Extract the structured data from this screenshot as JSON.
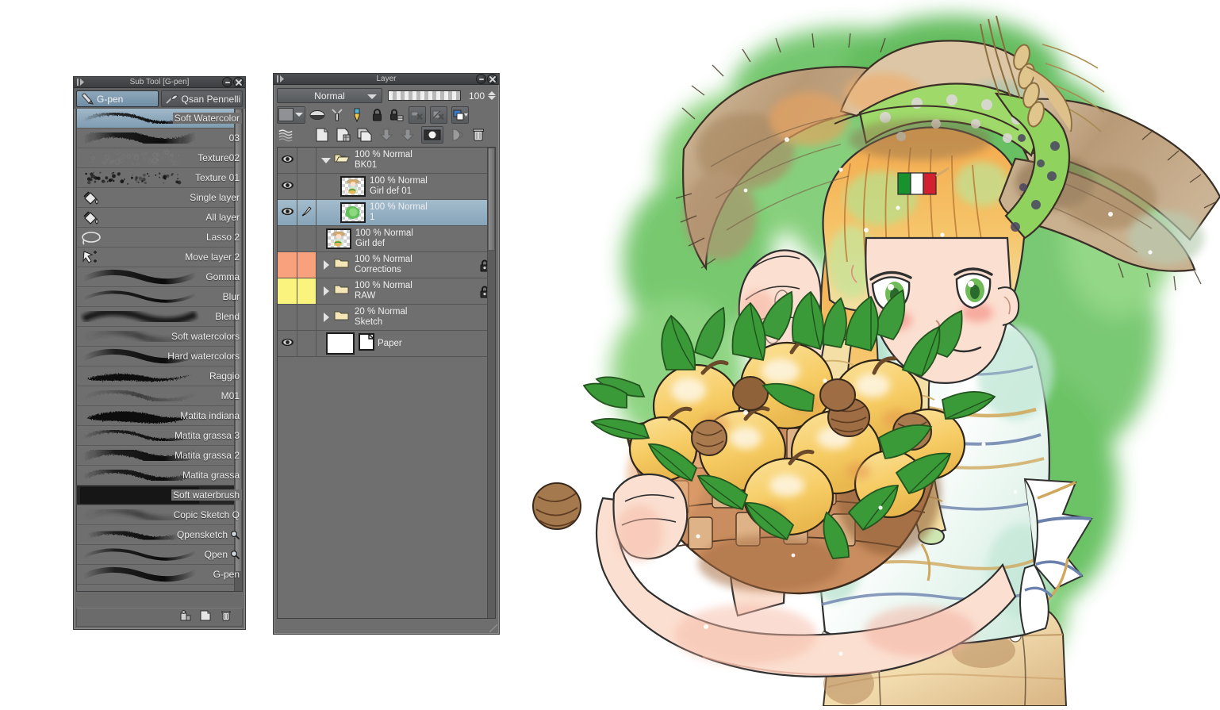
{
  "app": "Clip Studio Paint",
  "subtool_palette": {
    "title": "Sub Tool [G-pen]",
    "grip_icon": "drag-grip-icon",
    "minimize_label": "—",
    "close_label": "✕",
    "tabs": [
      {
        "label": "G-pen",
        "icon": "pen-icon",
        "active": true
      },
      {
        "label": "Qsan Pennelli",
        "icon": "brush-icon",
        "active": false
      }
    ],
    "items": [
      {
        "label": "G-pen",
        "stroke": "smooth-thick",
        "badge": "",
        "state": "normal"
      },
      {
        "label": "Qpen",
        "stroke": "tapered-thin",
        "badge": "magnify-icon",
        "state": "normal"
      },
      {
        "label": "Qpensketch",
        "stroke": "rough-speckle",
        "badge": "magnify-icon",
        "state": "normal"
      },
      {
        "label": "Copic Sketch Q",
        "stroke": "soft-fade",
        "badge": "",
        "state": "normal"
      },
      {
        "label": "Soft waterbrush",
        "stroke": "solid-dark",
        "badge": "",
        "state": "dark"
      },
      {
        "label": "Matita grassa",
        "stroke": "grain-medium",
        "badge": "",
        "state": "normal"
      },
      {
        "label": "Matita grassa 2",
        "stroke": "grain-wide",
        "badge": "",
        "state": "normal"
      },
      {
        "label": "Matita grassa 3",
        "stroke": "grain-thin",
        "badge": "",
        "state": "normal"
      },
      {
        "label": "Matita indiana",
        "stroke": "ink-blob",
        "badge": "",
        "state": "normal"
      },
      {
        "label": "M01",
        "stroke": "grain-light",
        "badge": "",
        "state": "normal"
      },
      {
        "label": "Raggio",
        "stroke": "sharp-ink",
        "badge": "",
        "state": "normal"
      },
      {
        "label": "Hard watercolors",
        "stroke": "smooth-thick",
        "badge": "",
        "state": "normal"
      },
      {
        "label": "Soft watercolors",
        "stroke": "soft-fade",
        "badge": "",
        "state": "normal"
      },
      {
        "label": "Blend",
        "stroke": "blur-soft",
        "badge": "",
        "state": "normal"
      },
      {
        "label": "Blur",
        "stroke": "tapered-thin",
        "badge": "",
        "state": "normal"
      },
      {
        "label": "Gomma",
        "stroke": "smooth-thick",
        "badge": "",
        "state": "normal"
      },
      {
        "label": "Move layer 2",
        "stroke": "move-layer-icon",
        "badge": "",
        "state": "normal"
      },
      {
        "label": "Lasso 2",
        "stroke": "lasso-icon",
        "badge": "",
        "state": "normal"
      },
      {
        "label": "All layer",
        "stroke": "fill-bucket-icon",
        "badge": "",
        "state": "normal"
      },
      {
        "label": "Single layer",
        "stroke": "fill-bucket-icon",
        "badge": "",
        "state": "normal"
      },
      {
        "label": "Texture 01",
        "stroke": "spatter",
        "badge": "",
        "state": "normal"
      },
      {
        "label": "Texture02",
        "stroke": "spatter-faint",
        "badge": "",
        "state": "normal"
      },
      {
        "label": "03",
        "stroke": "grain-wide",
        "badge": "",
        "state": "normal"
      },
      {
        "label": "Soft Watercolor",
        "stroke": "grain-thin",
        "badge": "",
        "state": "selected"
      }
    ],
    "footer_buttons": [
      {
        "name": "show-all-sub-tool-icon",
        "label": ""
      },
      {
        "name": "create-copy-of-sub-tool-icon",
        "label": ""
      },
      {
        "name": "delete-sub-tool-icon",
        "label": ""
      }
    ]
  },
  "layer_palette": {
    "title": "Layer",
    "minimize_label": "—",
    "close_label": "✕",
    "blend_mode": "Normal",
    "opacity_value": "100",
    "toolbar_row1": [
      {
        "name": "layer-color-swatch",
        "label": ""
      },
      {
        "name": "layer-mask-icon",
        "label": ""
      },
      {
        "name": "ruler-icon",
        "label": ""
      },
      {
        "name": "lock-transparent-pixels-icon",
        "label": ""
      },
      {
        "name": "lock-layer-icon",
        "label": ""
      },
      {
        "name": "lock-with-key-icon",
        "label": ""
      },
      {
        "name": "clip-to-layer-below-icon",
        "label": ""
      },
      {
        "name": "layer-mask-enable-icon",
        "label": ""
      },
      {
        "name": "palette-color-icon",
        "label": ""
      }
    ],
    "toolbar_row2": [
      {
        "name": "layer-properties-icon",
        "label": ""
      },
      {
        "name": "new-raster-layer-icon",
        "label": ""
      },
      {
        "name": "new-layer-folder-icon",
        "label": ""
      },
      {
        "name": "duplicate-layer-icon",
        "label": ""
      },
      {
        "name": "merge-down-icon",
        "label": ""
      },
      {
        "name": "combine-layers-icon",
        "label": ""
      },
      {
        "name": "layer-mask-button-icon",
        "label": ""
      },
      {
        "name": "apply-mask-icon",
        "label": ""
      },
      {
        "name": "delete-layer-icon",
        "label": ""
      }
    ],
    "columns": {
      "eye": "visibility",
      "brush": "reference",
      "content": "layer"
    },
    "layers": [
      {
        "blend": "100 % Normal",
        "name": "BK01",
        "kind": "folder-open",
        "visible": true,
        "reference": false,
        "expanded": true,
        "indent": 0,
        "selected": false,
        "locked": false,
        "color_tag": "",
        "thumb": "none"
      },
      {
        "blend": "100 % Normal",
        "name": "Girl def 01",
        "kind": "raster",
        "visible": true,
        "reference": false,
        "expanded": false,
        "indent": 1,
        "selected": false,
        "locked": false,
        "color_tag": "",
        "thumb": "girl"
      },
      {
        "blend": "100 % Normal",
        "name": "1",
        "kind": "raster",
        "visible": true,
        "reference": true,
        "expanded": false,
        "indent": 1,
        "selected": true,
        "locked": false,
        "color_tag": "",
        "thumb": "green-blob"
      },
      {
        "blend": "100 % Normal",
        "name": "Girl def",
        "kind": "raster",
        "visible": false,
        "reference": false,
        "expanded": false,
        "indent": 0,
        "selected": false,
        "locked": false,
        "color_tag": "",
        "thumb": "girl"
      },
      {
        "blend": "100 % Normal",
        "name": "Corrections",
        "kind": "folder",
        "visible": false,
        "reference": false,
        "expanded": false,
        "indent": 0,
        "selected": false,
        "locked": true,
        "color_tag": "#f9a07c",
        "thumb": "none"
      },
      {
        "blend": "100 % Normal",
        "name": "RAW",
        "kind": "folder",
        "visible": false,
        "reference": false,
        "expanded": false,
        "indent": 0,
        "selected": false,
        "locked": true,
        "color_tag": "#faf47e",
        "thumb": "none"
      },
      {
        "blend": "20 % Normal",
        "name": "Sketch",
        "kind": "folder",
        "visible": false,
        "reference": false,
        "expanded": false,
        "indent": 0,
        "selected": false,
        "locked": false,
        "color_tag": "",
        "thumb": "none"
      },
      {
        "blend": "",
        "name": "Paper",
        "kind": "paper",
        "visible": true,
        "reference": false,
        "expanded": false,
        "indent": 0,
        "selected": false,
        "locked": false,
        "color_tag": "",
        "thumb": "white"
      }
    ]
  },
  "canvas": {
    "name": "illustration-canvas",
    "description": "Anime illustration of a blonde girl in a wide straw hat with green polka-dot ribbon and wheat ears, holding a woven basket of yellow peaches with green leaves, against a green watercolor splash background",
    "background_color": "#ffffff",
    "accent_green": "#64bf5e",
    "skin_color": "#fbdfd0",
    "hair_color": "#f0a54e",
    "shirt_color": "#c9ead8",
    "fruit_color": "#f6cf6f",
    "hat_color": "#c3a98a",
    "pants_color": "#e8cfa2",
    "flag_colors": [
      "#18922e",
      "#ffffff",
      "#d22030"
    ]
  }
}
